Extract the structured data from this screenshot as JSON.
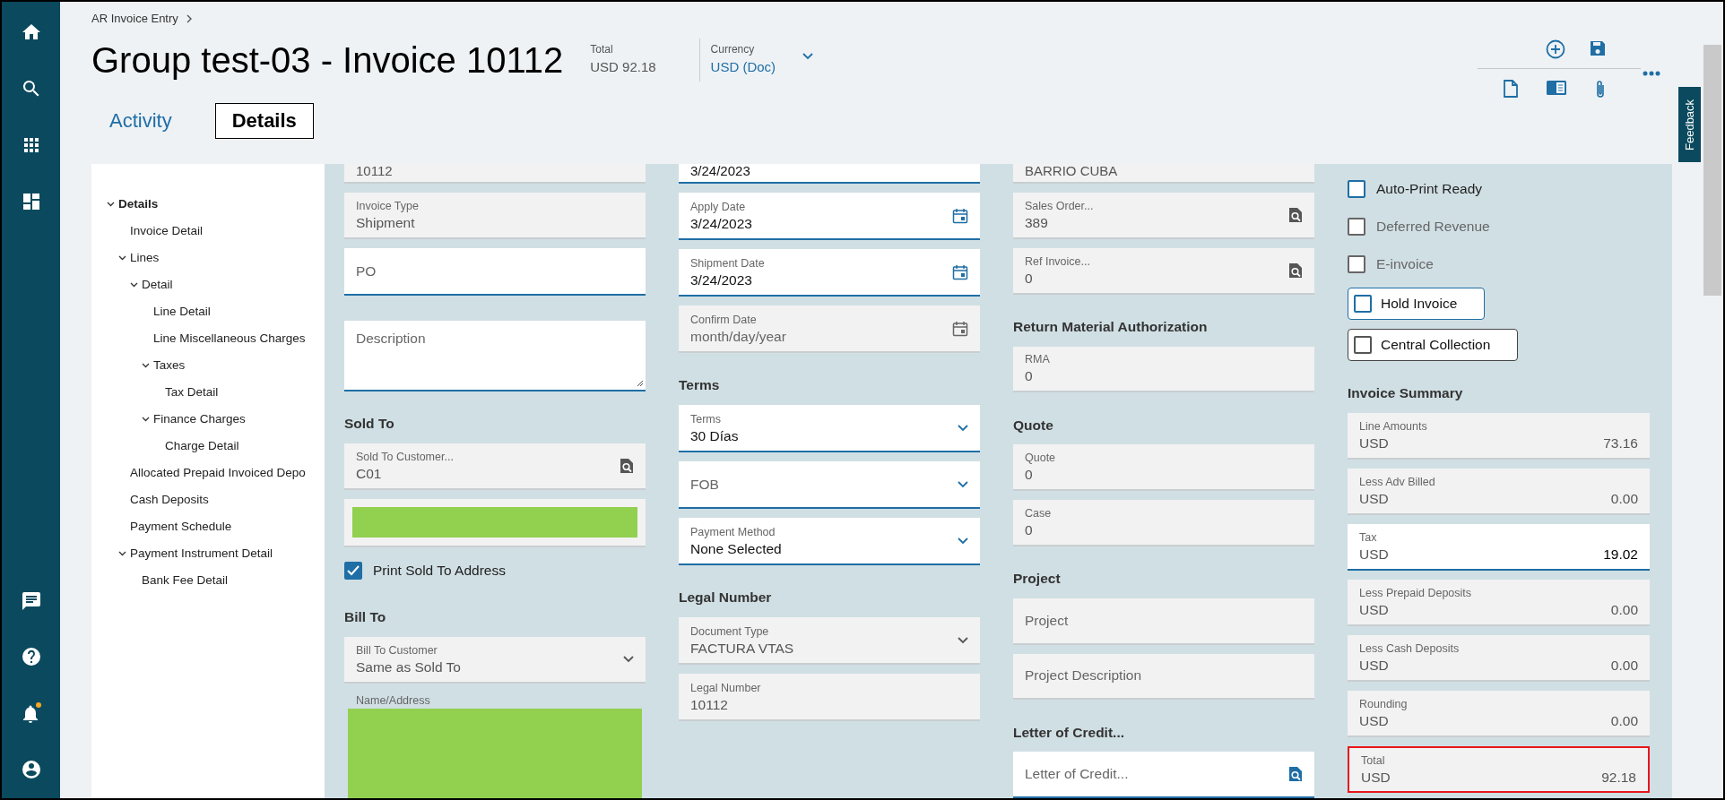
{
  "nav": {
    "notifications_unread": true
  },
  "breadcrumb": "AR Invoice Entry",
  "header": {
    "title": "Group test-03 - Invoice 10112",
    "total": {
      "label": "Total",
      "currency": "USD",
      "amount": "92.18"
    },
    "currency": {
      "label": "Currency",
      "value": "USD (Doc)"
    }
  },
  "tabs": [
    {
      "label": "Activity",
      "selected": false
    },
    {
      "label": "Details",
      "selected": true
    }
  ],
  "feedback": "Feedback",
  "tree": [
    {
      "label": "Details",
      "selected": true,
      "expanded": true,
      "children": [
        {
          "label": "Invoice Detail",
          "selected": false
        },
        {
          "label": "Lines",
          "selected": false,
          "expanded": true,
          "children": [
            {
              "label": "Detail",
              "selected": false,
              "expanded": true,
              "children": [
                {
                  "label": "Line Detail",
                  "selected": false
                },
                {
                  "label": "Line Miscellaneous Charges",
                  "selected": false
                },
                {
                  "label": "Taxes",
                  "selected": false,
                  "expanded": true,
                  "children": [
                    {
                      "label": "Tax Detail",
                      "selected": false
                    }
                  ]
                },
                {
                  "label": "Finance Charges",
                  "selected": false,
                  "expanded": true,
                  "children": [
                    {
                      "label": "Charge Detail",
                      "selected": false
                    }
                  ]
                }
              ]
            }
          ]
        },
        {
          "label": "Allocated Prepaid Invoiced Depo",
          "selected": false
        },
        {
          "label": "Cash Deposits",
          "selected": false
        },
        {
          "label": "Payment Schedule",
          "selected": false
        },
        {
          "label": "Payment Instrument Detail",
          "selected": false,
          "expanded": true,
          "children": [
            {
              "label": "Bank Fee Detail",
              "selected": false
            }
          ]
        }
      ]
    }
  ],
  "columns": [
    [
      {
        "kind": "clipped",
        "value": "10112",
        "editable": false
      },
      {
        "kind": "text_field",
        "label": "Invoice Type",
        "value": "Shipment",
        "editable": false
      },
      {
        "kind": "text_field",
        "placeholder": "PO",
        "editable": true
      },
      {
        "kind": "textarea",
        "placeholder": "Description",
        "editable": true
      },
      {
        "kind": "heading",
        "text": "Sold To"
      },
      {
        "kind": "lookup_field",
        "label": "Sold To Customer...",
        "value": "C01",
        "editable": false
      },
      {
        "kind": "redacted_field"
      },
      {
        "kind": "checkbox",
        "label": "Print Sold To Address",
        "checked": true,
        "disabled": false
      },
      {
        "kind": "heading",
        "text": "Bill To"
      },
      {
        "kind": "select_field",
        "label": "Bill To Customer",
        "value": "Same as Sold To",
        "editable": false
      },
      {
        "kind": "redacted_block",
        "label": "Name/Address"
      }
    ],
    [
      {
        "kind": "clipped",
        "value": "3/24/2023",
        "editable": true
      },
      {
        "kind": "date_field",
        "label": "Apply Date",
        "value": "3/24/2023",
        "editable": true
      },
      {
        "kind": "date_field",
        "label": "Shipment Date",
        "value": "3/24/2023",
        "editable": true
      },
      {
        "kind": "date_field",
        "label": "Confirm Date",
        "placeholder": "month/day/year",
        "editable": false
      },
      {
        "kind": "heading",
        "text": "Terms"
      },
      {
        "kind": "select_field",
        "label": "Terms",
        "value": "30 Días",
        "editable": true
      },
      {
        "kind": "select_field",
        "placeholder": "FOB",
        "editable": true
      },
      {
        "kind": "select_field",
        "label": "Payment Method",
        "value": "None Selected",
        "editable": true
      },
      {
        "kind": "heading",
        "text": "Legal Number"
      },
      {
        "kind": "select_field",
        "label": "Document Type",
        "value": "FACTURA VTAS",
        "editable": false
      },
      {
        "kind": "text_field",
        "label": "Legal Number",
        "value": "10112",
        "editable": false
      }
    ],
    [
      {
        "kind": "clipped",
        "value": "BARRIO CUBA",
        "editable": false
      },
      {
        "kind": "lookup_field",
        "label": "Sales Order...",
        "value": "389",
        "editable": false
      },
      {
        "kind": "lookup_field",
        "label": "Ref Invoice...",
        "value": "0",
        "editable": false
      },
      {
        "kind": "heading",
        "text": "Return Material Authorization"
      },
      {
        "kind": "text_field",
        "label": "RMA",
        "value": "0",
        "editable": false
      },
      {
        "kind": "heading",
        "text": "Quote"
      },
      {
        "kind": "text_field",
        "label": "Quote",
        "value": "0",
        "editable": false
      },
      {
        "kind": "text_field",
        "label": "Case",
        "value": "0",
        "editable": false
      },
      {
        "kind": "heading",
        "text": "Project"
      },
      {
        "kind": "text_field",
        "placeholder": "Project",
        "editable": false
      },
      {
        "kind": "text_field",
        "placeholder": "Project Description",
        "editable": false
      },
      {
        "kind": "heading",
        "text": "Letter of Credit..."
      },
      {
        "kind": "lookup_field",
        "placeholder": "Letter of Credit...",
        "editable": true
      }
    ],
    [
      {
        "kind": "checkbox",
        "label": "Auto-Print Ready",
        "checked": false,
        "disabled": false
      },
      {
        "kind": "checkbox",
        "label": "Deferred Revenue",
        "checked": false,
        "disabled": true
      },
      {
        "kind": "checkbox",
        "label": "E-invoice",
        "checked": false,
        "disabled": true
      },
      {
        "kind": "boxed_checkbox",
        "label": "Hold Invoice",
        "checked": false,
        "focused": true
      },
      {
        "kind": "boxed_checkbox",
        "label": "Central Collection",
        "checked": false,
        "focused": false
      },
      {
        "kind": "heading",
        "text": "Invoice Summary"
      },
      {
        "kind": "summary",
        "label": "Line Amounts",
        "currency": "USD",
        "amount": "73.16",
        "editable": false,
        "highlighted": false
      },
      {
        "kind": "summary",
        "label": "Less Adv Billed",
        "currency": "USD",
        "amount": "0.00",
        "editable": false,
        "highlighted": false
      },
      {
        "kind": "summary",
        "label": "Tax",
        "currency": "USD",
        "amount": "19.02",
        "editable": true,
        "highlighted": false
      },
      {
        "kind": "summary",
        "label": "Less Prepaid Deposits",
        "currency": "USD",
        "amount": "0.00",
        "editable": false,
        "highlighted": false
      },
      {
        "kind": "summary",
        "label": "Less Cash Deposits",
        "currency": "USD",
        "amount": "0.00",
        "editable": false,
        "highlighted": false
      },
      {
        "kind": "summary",
        "label": "Rounding",
        "currency": "USD",
        "amount": "0.00",
        "editable": false,
        "highlighted": false
      },
      {
        "kind": "summary",
        "label": "Total",
        "currency": "USD",
        "amount": "92.18",
        "editable": false,
        "highlighted": true
      }
    ]
  ]
}
